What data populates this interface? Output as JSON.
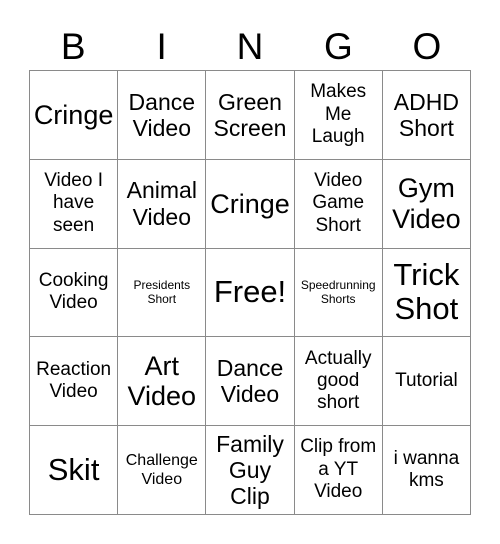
{
  "card": {
    "header_letters": [
      "B",
      "I",
      "N",
      "G",
      "O"
    ],
    "columns": 5,
    "rows": 5,
    "border_color": "#8a8a8a",
    "background_color": "#ffffff",
    "text_color": "#000000",
    "free_space": {
      "label": "Free!",
      "row": 3,
      "column": 3
    },
    "cells": [
      {
        "text": "Cringe",
        "size": "xl"
      },
      {
        "text": "Dance Video",
        "size": "l"
      },
      {
        "text": "Green Screen",
        "size": "l"
      },
      {
        "text": "Makes Me Laugh",
        "size": "m"
      },
      {
        "text": "ADHD Short",
        "size": "l"
      },
      {
        "text": "Video I have seen",
        "size": "m"
      },
      {
        "text": "Animal Video",
        "size": "l"
      },
      {
        "text": "Cringe",
        "size": "xl"
      },
      {
        "text": "Video Game Short",
        "size": "m"
      },
      {
        "text": "Gym Video",
        "size": "xl"
      },
      {
        "text": "Cooking Video",
        "size": "m"
      },
      {
        "text": "Presidents Short",
        "size": "xs"
      },
      {
        "text": "Free!",
        "size": "xxl"
      },
      {
        "text": "Speedrunning Shorts",
        "size": "xs"
      },
      {
        "text": "Trick Shot",
        "size": "xxl"
      },
      {
        "text": "Reaction Video",
        "size": "m"
      },
      {
        "text": "Art Video",
        "size": "xl"
      },
      {
        "text": "Dance Video",
        "size": "l"
      },
      {
        "text": "Actually good short",
        "size": "m"
      },
      {
        "text": "Tutorial",
        "size": "m"
      },
      {
        "text": "Skit",
        "size": "xxl"
      },
      {
        "text": "Challenge Video",
        "size": "s"
      },
      {
        "text": "Family Guy Clip",
        "size": "l"
      },
      {
        "text": "Clip from a YT Video",
        "size": "m"
      },
      {
        "text": "i wanna kms",
        "size": "m"
      }
    ]
  }
}
